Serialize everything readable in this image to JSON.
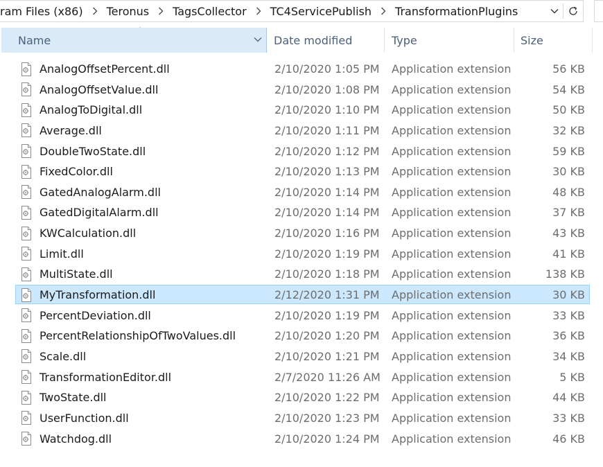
{
  "address_bar": {
    "crumbs": [
      "ram Files (x86)",
      "Teronus",
      "TagsCollector",
      "TC4ServicePublish",
      "TransformationPlugins"
    ]
  },
  "columns": {
    "name": "Name",
    "date_modified": "Date modified",
    "type": "Type",
    "size": "Size"
  },
  "files": [
    {
      "name": "AnalogOffsetPercent.dll",
      "date": "2/10/2020 1:05 PM",
      "type": "Application extension",
      "size": "56 KB",
      "selected": false
    },
    {
      "name": "AnalogOffsetValue.dll",
      "date": "2/10/2020 1:08 PM",
      "type": "Application extension",
      "size": "54 KB",
      "selected": false
    },
    {
      "name": "AnalogToDigital.dll",
      "date": "2/10/2020 1:10 PM",
      "type": "Application extension",
      "size": "50 KB",
      "selected": false
    },
    {
      "name": "Average.dll",
      "date": "2/10/2020 1:11 PM",
      "type": "Application extension",
      "size": "32 KB",
      "selected": false
    },
    {
      "name": "DoubleTwoState.dll",
      "date": "2/10/2020 1:12 PM",
      "type": "Application extension",
      "size": "59 KB",
      "selected": false
    },
    {
      "name": "FixedColor.dll",
      "date": "2/10/2020 1:13 PM",
      "type": "Application extension",
      "size": "30 KB",
      "selected": false
    },
    {
      "name": "GatedAnalogAlarm.dll",
      "date": "2/10/2020 1:14 PM",
      "type": "Application extension",
      "size": "48 KB",
      "selected": false
    },
    {
      "name": "GatedDigitalAlarm.dll",
      "date": "2/10/2020 1:14 PM",
      "type": "Application extension",
      "size": "37 KB",
      "selected": false
    },
    {
      "name": "KWCalculation.dll",
      "date": "2/10/2020 1:16 PM",
      "type": "Application extension",
      "size": "43 KB",
      "selected": false
    },
    {
      "name": "Limit.dll",
      "date": "2/10/2020 1:19 PM",
      "type": "Application extension",
      "size": "41 KB",
      "selected": false
    },
    {
      "name": "MultiState.dll",
      "date": "2/10/2020 1:18 PM",
      "type": "Application extension",
      "size": "138 KB",
      "selected": false
    },
    {
      "name": "MyTransformation.dll",
      "date": "2/12/2020 1:31 PM",
      "type": "Application extension",
      "size": "30 KB",
      "selected": true
    },
    {
      "name": "PercentDeviation.dll",
      "date": "2/10/2020 1:19 PM",
      "type": "Application extension",
      "size": "33 KB",
      "selected": false
    },
    {
      "name": "PercentRelationshipOfTwoValues.dll",
      "date": "2/10/2020 1:20 PM",
      "type": "Application extension",
      "size": "36 KB",
      "selected": false
    },
    {
      "name": "Scale.dll",
      "date": "2/10/2020 1:21 PM",
      "type": "Application extension",
      "size": "34 KB",
      "selected": false
    },
    {
      "name": "TransformationEditor.dll",
      "date": "2/7/2020 11:26 AM",
      "type": "Application extension",
      "size": "5 KB",
      "selected": false
    },
    {
      "name": "TwoState.dll",
      "date": "2/10/2020 1:22 PM",
      "type": "Application extension",
      "size": "44 KB",
      "selected": false
    },
    {
      "name": "UserFunction.dll",
      "date": "2/10/2020 1:23 PM",
      "type": "Application extension",
      "size": "33 KB",
      "selected": false
    },
    {
      "name": "Watchdog.dll",
      "date": "2/10/2020 1:24 PM",
      "type": "Application extension",
      "size": "46 KB",
      "selected": false
    }
  ],
  "icons": {
    "file": "dll-file-icon",
    "separator": "chevron-right-icon",
    "dropdown": "chevron-down-icon",
    "refresh": "refresh-icon",
    "sort": "sort-ascending-icon"
  },
  "colors": {
    "selection_bg": "#cce8ff",
    "selection_border": "#99d1ff",
    "header_hover": "#d9ebf9",
    "header_text": "#4c607a",
    "secondary_text": "#6d6d6d"
  }
}
